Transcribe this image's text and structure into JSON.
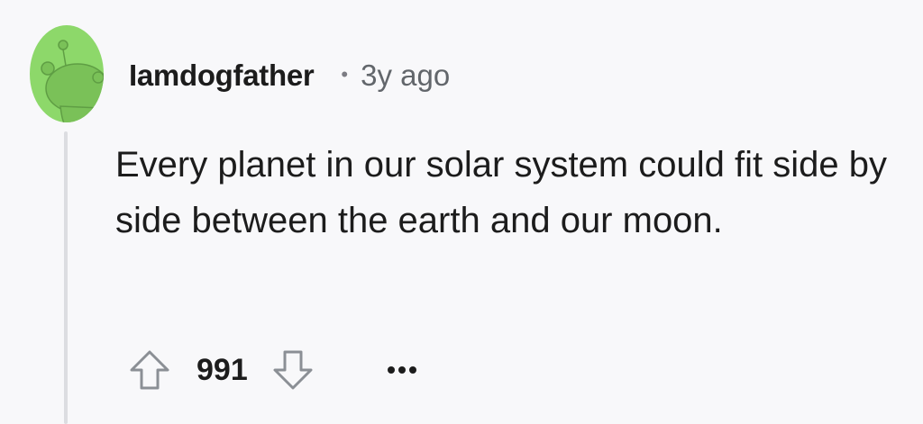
{
  "comment": {
    "username": "Iamdogfather",
    "separator": "•",
    "timestamp": "3y ago",
    "body": "Every planet in our solar system could fit side by side between the earth and our moon.",
    "score": "991",
    "avatar_color": "#8dd86a",
    "avatar_icon": "snoo-avatar"
  },
  "actions": {
    "upvote_icon": "arrow-up-icon",
    "downvote_icon": "arrow-down-icon",
    "more_icon": "ellipsis-icon"
  }
}
